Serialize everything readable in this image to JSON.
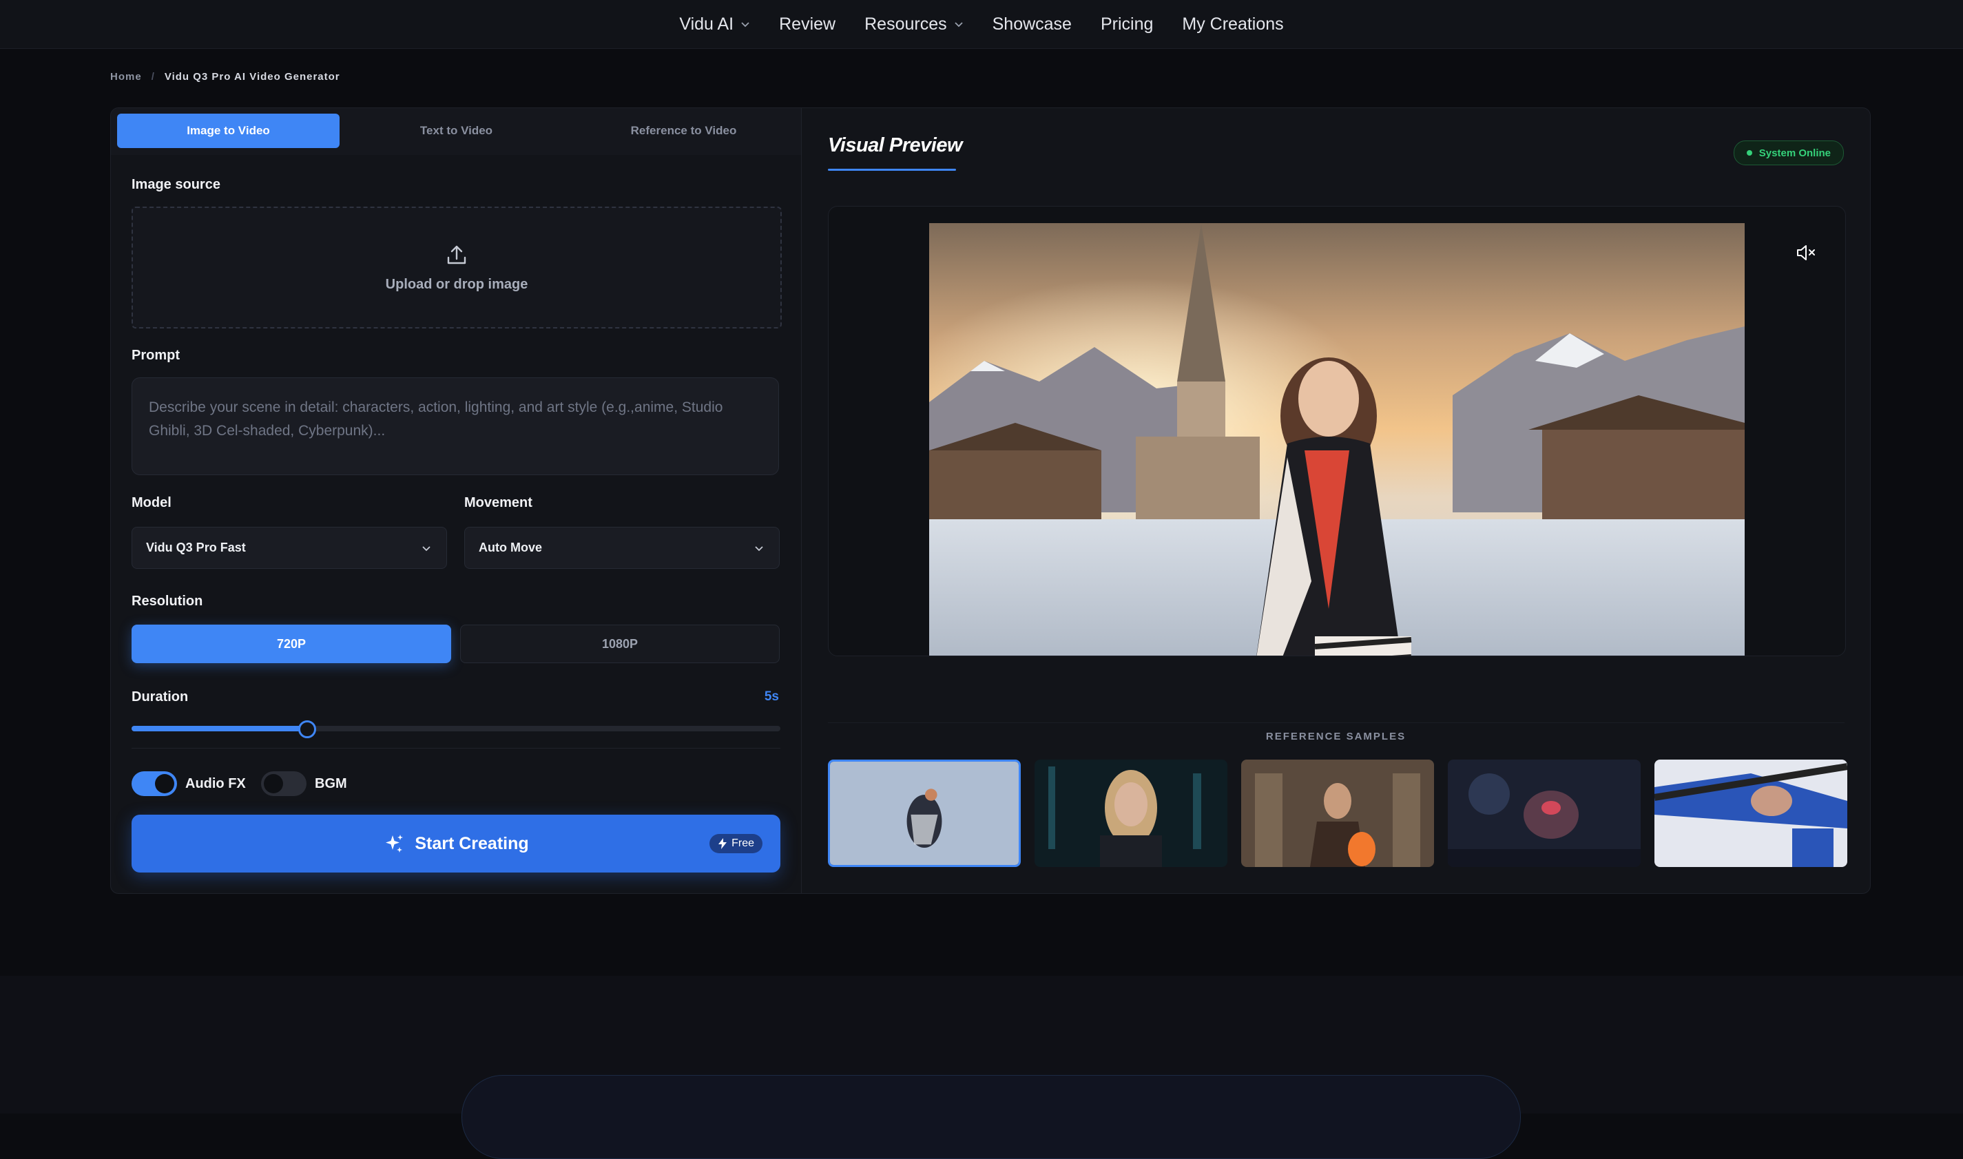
{
  "nav": {
    "items": [
      {
        "label": "Vidu AI",
        "dropdown": true
      },
      {
        "label": "Review",
        "dropdown": false
      },
      {
        "label": "Resources",
        "dropdown": true
      },
      {
        "label": "Showcase",
        "dropdown": false
      },
      {
        "label": "Pricing",
        "dropdown": false
      },
      {
        "label": "My Creations",
        "dropdown": false
      }
    ]
  },
  "breadcrumb": {
    "home": "Home",
    "separator": "/",
    "current": "Vidu Q3 Pro AI Video Generator"
  },
  "tabs": [
    {
      "label": "Image to Video",
      "active": true
    },
    {
      "label": "Text to Video",
      "active": false
    },
    {
      "label": "Reference to Video",
      "active": false
    }
  ],
  "form": {
    "image_source_label": "Image source",
    "upload_text": "Upload or drop image",
    "prompt_label": "Prompt",
    "prompt_placeholder": "Describe your scene in detail: characters, action, lighting, and art style (e.g.,anime, Studio Ghibli, 3D Cel-shaded, Cyberpunk)...",
    "model_label": "Model",
    "model_value": "Vidu Q3 Pro Fast",
    "movement_label": "Movement",
    "movement_value": "Auto Move",
    "resolution_label": "Resolution",
    "resolutions": [
      {
        "label": "720P",
        "active": true
      },
      {
        "label": "1080P",
        "active": false
      }
    ],
    "duration_label": "Duration",
    "duration_value": "5s",
    "duration_fraction": 0.27,
    "audio_fx_label": "Audio FX",
    "audio_fx_on": true,
    "bgm_label": "BGM",
    "bgm_on": false,
    "start_label": "Start Creating",
    "free_label": "Free"
  },
  "preview": {
    "title": "Visual Preview",
    "status": "System Online",
    "mute_icon": "speaker-muted-icon",
    "reference_title": "REFERENCE SAMPLES",
    "samples": [
      {
        "name": "skater-dress",
        "selected": true
      },
      {
        "name": "cyber-woman",
        "selected": false
      },
      {
        "name": "fire-mage",
        "selected": false
      },
      {
        "name": "space-mech",
        "selected": false
      },
      {
        "name": "samurai-sword",
        "selected": false
      }
    ]
  },
  "colors": {
    "accent": "#3f86f5",
    "background": "#0b0c10",
    "card": "#121419",
    "online": "#35d17a"
  }
}
